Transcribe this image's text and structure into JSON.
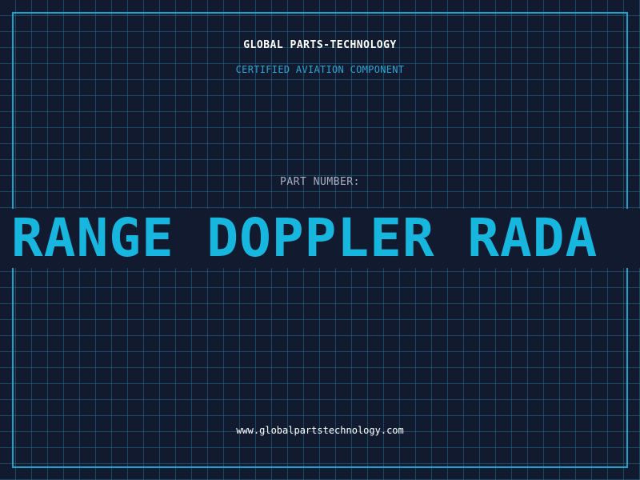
{
  "header": {
    "company": "GLOBAL PARTS-TECHNOLOGY",
    "subtitle": "CERTIFIED AVIATION COMPONENT"
  },
  "part": {
    "label": "PART NUMBER:",
    "value": "RANGE DOPPLER RADA"
  },
  "footer": {
    "website": "www.globalpartstechnology.com"
  },
  "colors": {
    "background": "#111a2e",
    "grid": "#1c6e8c",
    "accent": "#17b6de",
    "frame": "#1aa3cc"
  }
}
